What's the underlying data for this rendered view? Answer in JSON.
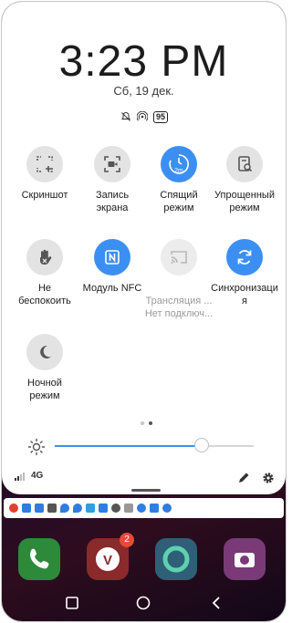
{
  "lockscreen": {
    "time": "3:23 PM",
    "date": "Сб, 19 дек.",
    "battery": "95"
  },
  "tiles": [
    {
      "label": "Скриншот",
      "icon": "screenshot-icon",
      "state": "off"
    },
    {
      "label": "Запись\nэкрана",
      "icon": "screen-record-icon",
      "state": "off"
    },
    {
      "label": "Спящий\nрежим",
      "icon": "sleep-timer-icon",
      "state": "on",
      "badge": "2m"
    },
    {
      "label": "Упрощенный\nрежим",
      "icon": "simple-mode-icon",
      "state": "off"
    },
    {
      "label": "Не\nбеспокоить",
      "icon": "do-not-disturb-icon",
      "state": "off"
    },
    {
      "label": "Модуль NFC",
      "icon": "nfc-icon",
      "state": "on"
    },
    {
      "label": "Трансляция ...",
      "sub": "Нет подключ...",
      "icon": "cast-icon",
      "state": "disabled"
    },
    {
      "label": "Синхронизаци\nя",
      "icon": "sync-icon",
      "state": "on"
    },
    {
      "label": "Ночной\nрежим",
      "icon": "night-mode-icon",
      "state": "off"
    }
  ],
  "brightness": {
    "level": 0.74
  },
  "network": {
    "type": "4G"
  },
  "dock": [
    {
      "icon": "phone-app-icon"
    },
    {
      "icon": "viber-app-icon",
      "badge": "2"
    },
    {
      "icon": "edge-app-icon"
    },
    {
      "icon": "camera-app-icon"
    }
  ],
  "colors": {
    "accent": "#3c8ff2",
    "panel": "#ffffff",
    "text": "#1c1c1c"
  }
}
